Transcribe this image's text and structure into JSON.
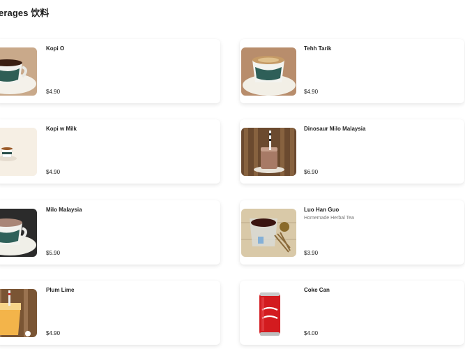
{
  "section": {
    "title": "erages 饮料"
  },
  "items": [
    {
      "name": "Kopi O",
      "desc": "",
      "price": "$4.90",
      "image_icon": "kopi-o-coffee-cup-icon"
    },
    {
      "name": "Tehh Tarik",
      "desc": "",
      "price": "$4.90",
      "image_icon": "teh-tarik-cup-icon"
    },
    {
      "name": "Kopi w Milk",
      "desc": "",
      "price": "$4.90",
      "image_icon": "kopi-milk-cup-icon"
    },
    {
      "name": "Dinosaur Milo Malaysia",
      "desc": "",
      "price": "$6.90",
      "image_icon": "dinosaur-milo-jar-icon"
    },
    {
      "name": "Milo Malaysia",
      "desc": "",
      "price": "$5.90",
      "image_icon": "milo-cup-icon"
    },
    {
      "name": "Luo Han Guo",
      "desc": "Homemade Herbal Tea",
      "price": "$3.90",
      "image_icon": "herbal-tea-glass-icon"
    },
    {
      "name": "Plum Lime",
      "desc": "",
      "price": "$4.90",
      "image_icon": "plum-lime-drink-icon"
    },
    {
      "name": "Coke Can",
      "desc": "",
      "price": "$4.00",
      "image_icon": "coke-can-icon"
    }
  ]
}
